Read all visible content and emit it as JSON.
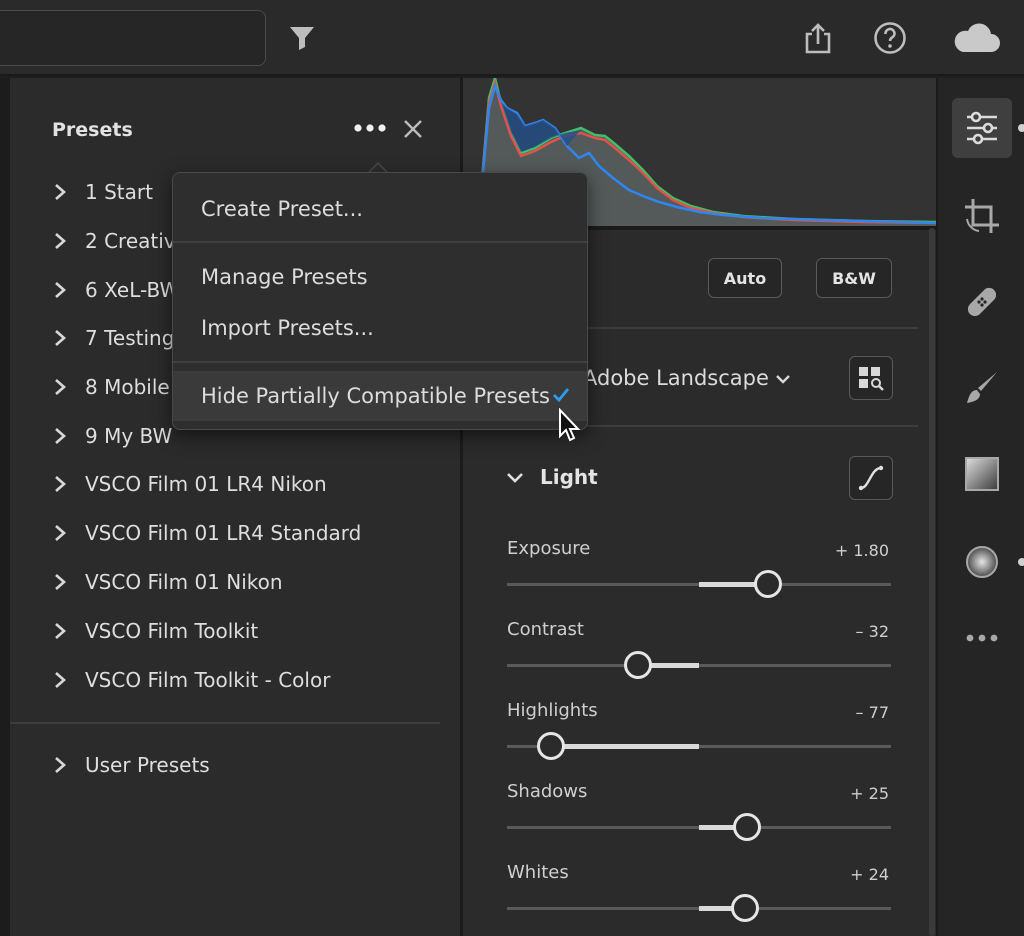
{
  "presets_panel": {
    "title": "Presets",
    "groups": [
      {
        "label": "1 Start"
      },
      {
        "label": "2 Creative"
      },
      {
        "label": "6 XeL-BW"
      },
      {
        "label": "7 Testing"
      },
      {
        "label": "8 Mobile"
      },
      {
        "label": "9 My BW"
      },
      {
        "label": "VSCO Film 01 LR4 Nikon"
      },
      {
        "label": "VSCO Film 01 LR4 Standard"
      },
      {
        "label": "VSCO Film 01 Nikon"
      },
      {
        "label": "VSCO Film Toolkit"
      },
      {
        "label": "VSCO Film Toolkit - Color"
      }
    ],
    "user_presets": "User Presets"
  },
  "menu": {
    "create": "Create Preset...",
    "manage": "Manage Presets",
    "import": "Import Presets...",
    "hide_partial": "Hide Partially Compatible Presets",
    "hide_partial_checked": true
  },
  "edit_panel": {
    "auto": "Auto",
    "bw": "B&W",
    "profile": "Adobe Landscape",
    "light_title": "Light",
    "sliders": [
      {
        "label": "Exposure",
        "value": "+ 1.80",
        "amount": 1.8,
        "min": -5,
        "max": 5
      },
      {
        "label": "Contrast",
        "value": "– 32",
        "amount": -32,
        "min": -100,
        "max": 100
      },
      {
        "label": "Highlights",
        "value": "– 77",
        "amount": -77,
        "min": -100,
        "max": 100
      },
      {
        "label": "Shadows",
        "value": "+ 25",
        "amount": 25,
        "min": -100,
        "max": 100
      },
      {
        "label": "Whites",
        "value": "+ 24",
        "amount": 24,
        "min": -100,
        "max": 100
      }
    ]
  },
  "icons": {
    "top": [
      "filter-icon",
      "share-icon",
      "help-icon",
      "cloud-icon"
    ],
    "tools": [
      "edit-sliders-icon",
      "crop-icon",
      "healing-icon",
      "brush-icon",
      "linear-gradient-icon",
      "radial-gradient-icon",
      "more-tools-icon"
    ]
  },
  "colors": {
    "accent_check": "#2d9cf0",
    "hist_red": "#e0524a",
    "hist_green": "#3ec06a",
    "hist_blue": "#2f86f0"
  }
}
